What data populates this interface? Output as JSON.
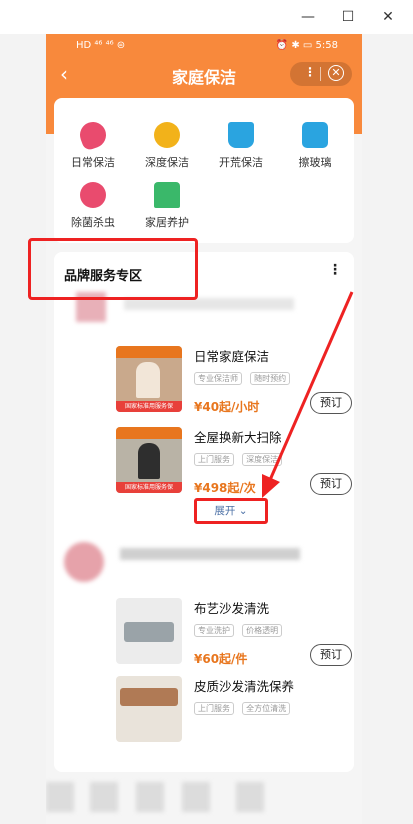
{
  "window": {
    "minimize_icon": "minimize-icon",
    "maximize_icon": "maximize-icon",
    "close_icon": "close-icon"
  },
  "status_bar": {
    "left": "HD ⁴⁶ ⁴⁶ ⊜",
    "right": "⏰ ✱ ▭ 5:58"
  },
  "nav": {
    "back": "‹",
    "title": "家庭保洁",
    "more": "⋮",
    "close": "✕"
  },
  "categories": [
    {
      "label": "日常保洁",
      "color": "#e94b6e"
    },
    {
      "label": "深度保洁",
      "color": "#f2b21a"
    },
    {
      "label": "开荒保洁",
      "color": "#2aa4e0"
    },
    {
      "label": "擦玻璃",
      "color": "#2aa4e0"
    },
    {
      "label": "除菌杀虫",
      "color": "#e94b6e"
    },
    {
      "label": "家居养护",
      "color": "#3ab86a"
    }
  ],
  "brand": {
    "title": "品牌服务专区",
    "more": "⋮",
    "expand": "展开 ⌄"
  },
  "items": [
    {
      "name": "日常家庭保洁",
      "tags": [
        "专业保洁师",
        "随时预约"
      ],
      "price": "¥40起/小时",
      "book": "预订",
      "badge": "国家标准用服务保"
    },
    {
      "name": "全屋换新大扫除",
      "tags": [
        "上门服务",
        "深度保洁"
      ],
      "price": "¥498起/次",
      "book": "预订",
      "badge": "国家标准用服务保"
    },
    {
      "name": "布艺沙发清洗",
      "tags": [
        "专业洗护",
        "价格透明"
      ],
      "price": "¥60起/件",
      "book": "预订"
    },
    {
      "name": "皮质沙发清洗保养",
      "tags": [
        "上门服务",
        "全方位清洗"
      ]
    }
  ],
  "colors": {
    "accent": "#f8893c",
    "price": "#e8761e",
    "highlight": "#ee2222"
  }
}
